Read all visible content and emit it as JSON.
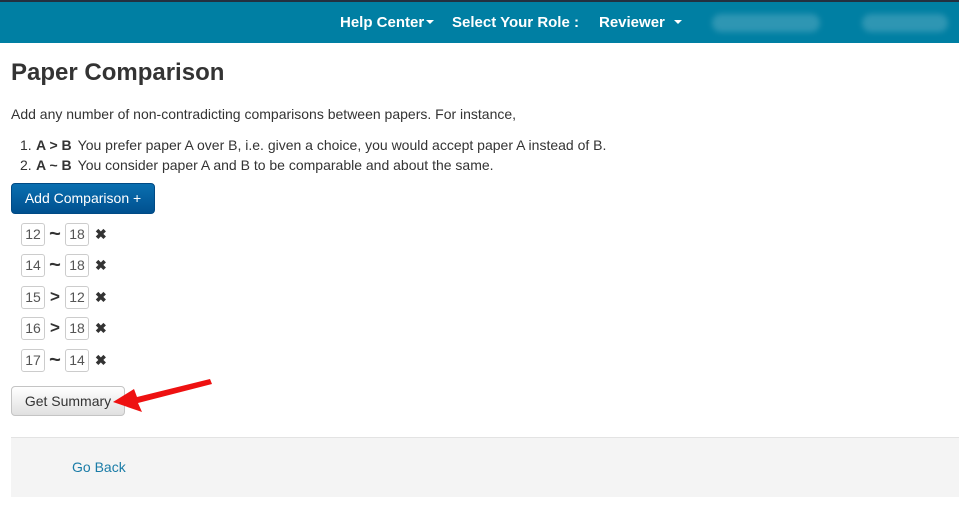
{
  "navbar": {
    "help_center": "Help Center",
    "select_role_label": "Select Your Role :",
    "role": "Reviewer",
    "bg_color": "#007fa3"
  },
  "page": {
    "title": "Paper Comparison",
    "intro": "Add any number of non-contradicting comparisons between papers. For instance,",
    "rules": [
      {
        "num": "1.",
        "symbol": "A > B",
        "text": "You prefer paper A over B, i.e. given a choice, you would accept paper A instead of B."
      },
      {
        "num": "2.",
        "symbol": "A ~ B",
        "text": "You consider paper A and B to be comparable and about the same."
      }
    ]
  },
  "buttons": {
    "add_comparison": "Add Comparison +",
    "get_summary": "Get Summary"
  },
  "comparisons": [
    {
      "a": "12",
      "op": "~",
      "b": "18",
      "remove": "✖"
    },
    {
      "a": "14",
      "op": "~",
      "b": "18",
      "remove": "✖"
    },
    {
      "a": "15",
      "op": ">",
      "b": "12",
      "remove": "✖"
    },
    {
      "a": "16",
      "op": ">",
      "b": "18",
      "remove": "✖"
    },
    {
      "a": "17",
      "op": "~",
      "b": "14",
      "remove": "✖"
    }
  ],
  "footer": {
    "go_back": "Go Back"
  },
  "annotation": {
    "arrow_color": "#ee1111"
  }
}
